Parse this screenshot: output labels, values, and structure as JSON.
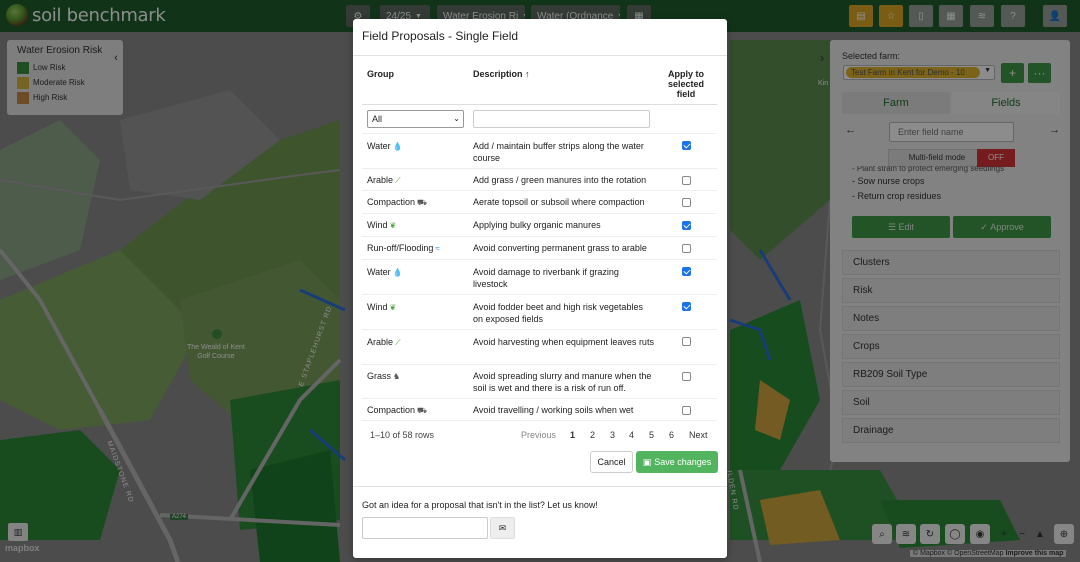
{
  "app": {
    "title": "soil benchmark",
    "season": "24/25",
    "layer_select": "Water Erosion Ri",
    "layer_select2": "Water (Ordnance"
  },
  "legend": {
    "title": "Water Erosion Risk",
    "items": [
      {
        "label": "Low Risk",
        "color": "#3a8f3e"
      },
      {
        "label": "Moderate Risk",
        "color": "#d6b640"
      },
      {
        "label": "High Risk",
        "color": "#c98a4a"
      }
    ]
  },
  "right_panel": {
    "selected_farm_label": "Selected farm:",
    "farm_name": "Test Farm in Kent for Demo - 10",
    "tab_farm": "Farm",
    "tab_fields": "Fields",
    "field_placeholder": "Enter field name",
    "multi_field_label": "Multi-field mode",
    "multi_field_state": "OFF",
    "details_cut": "- Plant strain to protect emerging seedlings",
    "details": [
      "- Sow nurse crops",
      "- Return crop residues"
    ],
    "edit_label": "Edit",
    "approve_label": "Approve",
    "sections": [
      "Clusters",
      "Risk",
      "Notes",
      "Crops",
      "RB209 Soil Type",
      "Soil",
      "Drainage"
    ]
  },
  "map": {
    "place_label": "The Weald of Kent Golf Course",
    "place_label_line1": "The Weald of Kent",
    "place_label_line2": "Golf Course",
    "road_maidstone": "MAIDSTONE RD",
    "road_staplehurst": "E STAPLEHURST RD",
    "road_ilden": "ILDEN RD",
    "road_number": "A274",
    "corner_label": "Kin",
    "mapbox_logo": "mapbox",
    "attribution_mapbox": "© Mapbox",
    "attribution_osm": "© OpenStreetMap",
    "attribution_improve": "Improve this map"
  },
  "modal": {
    "title": "Field Proposals - Single Field",
    "col_group": "Group",
    "col_description": "Description",
    "col_apply_1": "Apply to",
    "col_apply_2": "selected",
    "col_apply_3": "field",
    "filter_group_value": "All",
    "rows": [
      {
        "group": "Water",
        "icon": "water-drop-icon",
        "description": "Add / maintain buffer strips along the water course",
        "checked": true
      },
      {
        "group": "Arable",
        "icon": "sprout-icon",
        "description": "Add grass / green manures into the rotation",
        "checked": false
      },
      {
        "group": "Compaction",
        "icon": "tractor-icon",
        "description": "Aerate topsoil or subsoil where compaction",
        "checked": false
      },
      {
        "group": "Wind",
        "icon": "leaf-icon",
        "description": "Applying bulky organic manures",
        "checked": true
      },
      {
        "group": "Run-off/Flooding",
        "icon": "wave-icon",
        "description": "Avoid converting permanent grass to arable",
        "checked": false
      },
      {
        "group": "Water",
        "icon": "water-drop-icon",
        "description": "Avoid damage to riverbank if grazing livestock",
        "checked": true
      },
      {
        "group": "Wind",
        "icon": "leaf-icon",
        "description": "Avoid fodder beet and high risk vegetables on exposed fields",
        "checked": true
      },
      {
        "group": "Arable",
        "icon": "sprout-icon",
        "description": "Avoid harvesting when equipment leaves ruts",
        "checked": false
      },
      {
        "group": "Grass",
        "icon": "cow-icon",
        "description": "Avoid spreading slurry and manure when the soil is wet and there is a risk of run off.",
        "checked": false
      },
      {
        "group": "Compaction",
        "icon": "tractor-icon",
        "description": "Avoid travelling / working soils when wet",
        "checked": false
      }
    ],
    "rows_count": "1–10 of 58 rows",
    "pager_previous": "Previous",
    "pages": [
      "1",
      "2",
      "3",
      "4",
      "5",
      "6"
    ],
    "current_page": 1,
    "pager_next": "Next",
    "cancel_label": "Cancel",
    "save_label": "Save changes",
    "idea_text": "Got an idea for a proposal that isn't in the list? Let us know!"
  }
}
